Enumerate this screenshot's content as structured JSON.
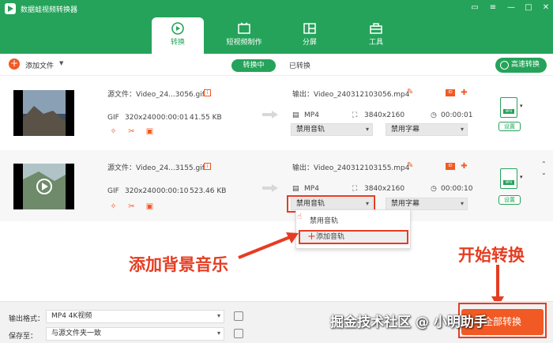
{
  "app": {
    "title": "数据蛙视频转换器"
  },
  "tabs": [
    {
      "label": "转换"
    },
    {
      "label": "短视频制作"
    },
    {
      "label": "分屏"
    },
    {
      "label": "工具"
    }
  ],
  "toolbar": {
    "add_file": "添加文件",
    "converting": "转换中",
    "converted": "已转换",
    "fast_convert": "高速转换"
  },
  "files": [
    {
      "source": "源文件：Video_24...3056.gif",
      "format": "GIF",
      "resolution": "320x240",
      "duration": "00:00:01",
      "size": "41.55 KB",
      "output": "输出：Video_240312103056.mp4",
      "out_format": "MP4",
      "out_resolution": "3840x2160",
      "out_duration": "00:00:01",
      "audio": "禁用音轨",
      "subtitle": "禁用字幕",
      "setting": "设置"
    },
    {
      "source": "源文件：Video_24...3155.gif",
      "format": "GIF",
      "resolution": "320x240",
      "duration": "00:00:10",
      "size": "523.46 KB",
      "output": "输出：Video_240312103155.mp4",
      "out_format": "MP4",
      "out_resolution": "3840x2160",
      "out_duration": "00:00:10",
      "audio": "禁用音轨",
      "subtitle": "禁用字幕",
      "setting": "设置"
    }
  ],
  "dropdown": {
    "items": [
      "禁用音轨",
      "添加音轨"
    ]
  },
  "annotations": {
    "add_bgm": "添加背景音乐",
    "start_convert": "开始转换"
  },
  "bottom": {
    "format_label": "输出格式：",
    "format_value": "MP4 4K视频",
    "save_label": "保存至：",
    "save_value": "与源文件夹一致",
    "convert_button": "全部转换"
  },
  "watermark": "掘金技术社区 @ 小明助手",
  "colors": {
    "brand": "#25a35a",
    "accent": "#f15a24",
    "highlight": "#e53d22"
  }
}
